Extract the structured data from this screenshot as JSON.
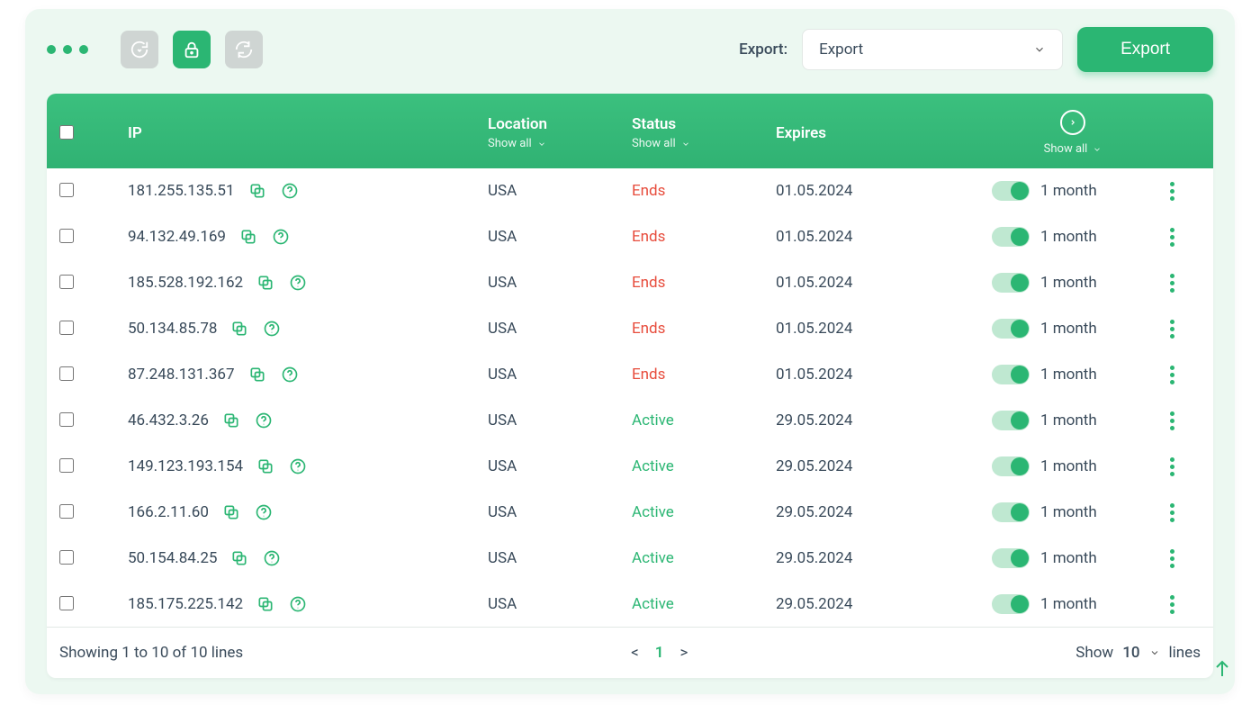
{
  "toolbar": {
    "export_label": "Export:",
    "export_select_value": "Export",
    "export_button": "Export"
  },
  "columns": {
    "ip": "IP",
    "location": "Location",
    "status": "Status",
    "expires": "Expires",
    "show_all": "Show all"
  },
  "rows": [
    {
      "ip": "181.255.135.51",
      "location": "USA",
      "status": "Ends",
      "status_class": "ends",
      "expires": "01.05.2024",
      "renew": "1 month"
    },
    {
      "ip": "94.132.49.169",
      "location": "USA",
      "status": "Ends",
      "status_class": "ends",
      "expires": "01.05.2024",
      "renew": "1 month"
    },
    {
      "ip": "185.528.192.162",
      "location": "USA",
      "status": "Ends",
      "status_class": "ends",
      "expires": "01.05.2024",
      "renew": "1 month"
    },
    {
      "ip": "50.134.85.78",
      "location": "USA",
      "status": "Ends",
      "status_class": "ends",
      "expires": "01.05.2024",
      "renew": "1 month"
    },
    {
      "ip": "87.248.131.367",
      "location": "USA",
      "status": "Ends",
      "status_class": "ends",
      "expires": "01.05.2024",
      "renew": "1 month"
    },
    {
      "ip": "46.432.3.26",
      "location": "USA",
      "status": "Active",
      "status_class": "active",
      "expires": "29.05.2024",
      "renew": "1 month"
    },
    {
      "ip": "149.123.193.154",
      "location": "USA",
      "status": "Active",
      "status_class": "active",
      "expires": "29.05.2024",
      "renew": "1 month"
    },
    {
      "ip": "166.2.11.60",
      "location": "USA",
      "status": "Active",
      "status_class": "active",
      "expires": "29.05.2024",
      "renew": "1 month"
    },
    {
      "ip": "50.154.84.25",
      "location": "USA",
      "status": "Active",
      "status_class": "active",
      "expires": "29.05.2024",
      "renew": "1 month"
    },
    {
      "ip": "185.175.225.142",
      "location": "USA",
      "status": "Active",
      "status_class": "active",
      "expires": "29.05.2024",
      "renew": "1 month"
    }
  ],
  "footer": {
    "summary": "Showing 1 to 10 of 10 lines",
    "current_page": "1",
    "prev": "<",
    "next": ">",
    "show": "Show",
    "page_size": "10",
    "lines": "lines"
  }
}
